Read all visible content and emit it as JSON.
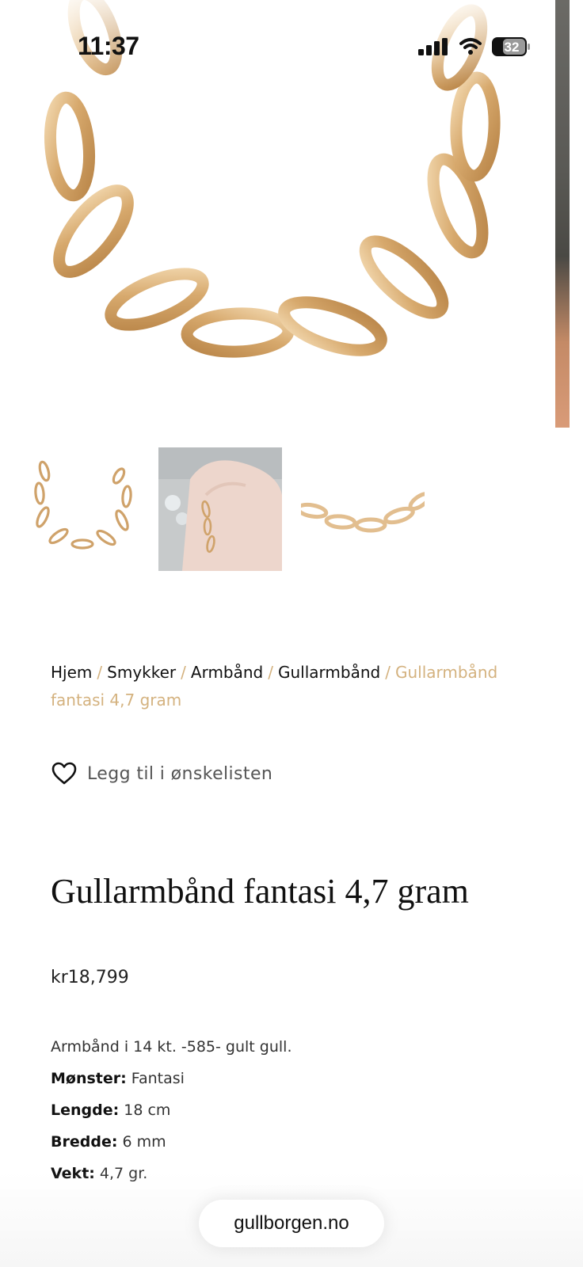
{
  "status_bar": {
    "time": "11:37",
    "battery_level": "32",
    "icons": [
      "signal-icon",
      "wifi-icon",
      "battery-icon"
    ]
  },
  "gallery": {
    "thumbnails": [
      "bracelet-full-view",
      "bracelet-on-wrist",
      "bracelet-close-up"
    ],
    "gold_color": "#d7a96d"
  },
  "breadcrumb": {
    "items": [
      "Hjem",
      "Smykker",
      "Armbånd",
      "Gullarmbånd"
    ],
    "separator": "/",
    "current": "Gullarmbånd fantasi 4,7 gram",
    "accent_color": "#d4b27f"
  },
  "wishlist": {
    "label": "Legg til i ønskelisten",
    "icon": "heart-icon"
  },
  "product": {
    "title": "Gullarmbånd fantasi 4,7 gram",
    "price": "kr18,799",
    "description": "Armbånd i 14 kt. -585- gult gull.",
    "specs": [
      {
        "label": "Mønster:",
        "value": "Fantasi"
      },
      {
        "label": "Lengde:",
        "value": "18 cm"
      },
      {
        "label": "Bredde:",
        "value": "6 mm"
      },
      {
        "label": "Vekt:",
        "value": "4,7 gr."
      }
    ]
  },
  "browser": {
    "url": "gullborgen.no"
  }
}
